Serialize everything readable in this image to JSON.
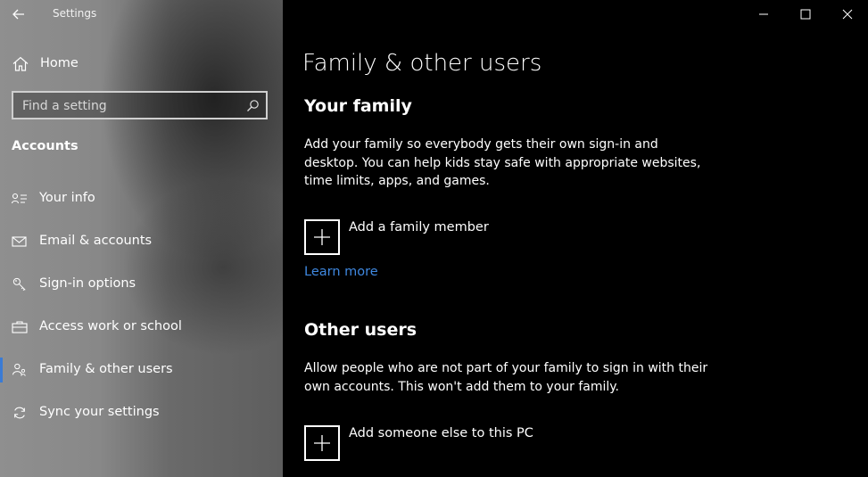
{
  "app": {
    "title": "Settings"
  },
  "sidebar": {
    "home_label": "Home",
    "search_placeholder": "Find a setting",
    "section_title": "Accounts",
    "items": [
      {
        "label": "Your info",
        "icon": "person-card-icon",
        "selected": false
      },
      {
        "label": "Email & accounts",
        "icon": "mail-icon",
        "selected": false
      },
      {
        "label": "Sign-in options",
        "icon": "key-icon",
        "selected": false
      },
      {
        "label": "Access work or school",
        "icon": "briefcase-icon",
        "selected": false
      },
      {
        "label": "Family & other users",
        "icon": "family-icon",
        "selected": true
      },
      {
        "label": "Sync your settings",
        "icon": "sync-icon",
        "selected": false
      }
    ]
  },
  "main": {
    "page_title": "Family & other users",
    "family": {
      "heading": "Your family",
      "description": "Add your family so everybody gets their own sign-in and desktop. You can help kids stay safe with appropriate websites, time limits, apps, and games.",
      "add_label": "Add a family member",
      "learn_more": "Learn more"
    },
    "other": {
      "heading": "Other users",
      "description": "Allow people who are not part of your family to sign in with their own accounts. This won't add them to your family.",
      "add_label": "Add someone else to this PC"
    }
  },
  "colors": {
    "accent": "#3a7bd5",
    "link": "#3f88e0",
    "background": "#000000"
  }
}
